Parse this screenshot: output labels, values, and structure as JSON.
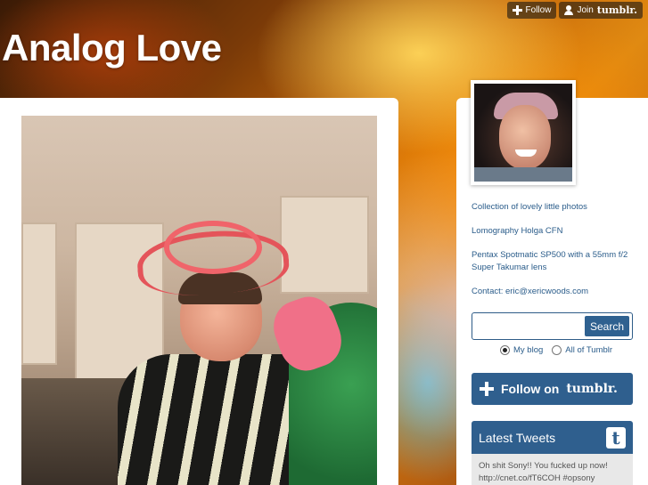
{
  "topbar": {
    "follow_label": "Follow",
    "join_prefix": "Join",
    "join_brand": "tumblr."
  },
  "blog": {
    "title": "Analog Love"
  },
  "sidebar": {
    "description": [
      "Collection of lovely little photos",
      "Lomography Holga CFN",
      "Pentax Spotmatic SP500 with a 55mm f/2 Super Takumar lens",
      "Contact: eric@xericwoods.com"
    ],
    "search": {
      "placeholder": "",
      "value": "",
      "button_label": "Search",
      "scope_options": [
        "My blog",
        "All of Tumblr"
      ],
      "scope_selected": "My blog"
    },
    "follow_tumblr": {
      "prefix": "Follow on",
      "brand": "tumblr."
    },
    "tweets": {
      "title": "Latest Tweets",
      "icon": "twitter-icon",
      "items": [
        "Oh shit Sony!! You fucked up now! http://cnet.co/fT6COH #opsony"
      ]
    }
  },
  "colors": {
    "accent": "#2f5f8e",
    "link": "#2a5c8a"
  }
}
